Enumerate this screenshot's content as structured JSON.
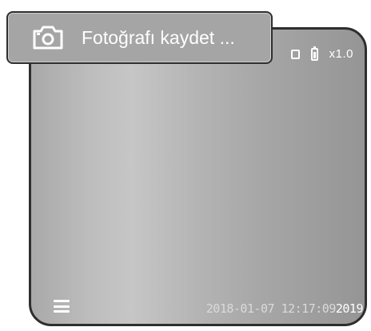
{
  "toast": {
    "icon": "camera-icon",
    "message": "Fotoğrafı kaydet ..."
  },
  "status_bar": {
    "storage_icon": "sd-card-icon",
    "battery_icon": "battery-icon",
    "zoom": "x1.0"
  },
  "bottom_bar": {
    "menu_icon": "menu-icon",
    "timestamp": "2018-01-07  12:17:09",
    "timestamp_overflow": "2019"
  }
}
